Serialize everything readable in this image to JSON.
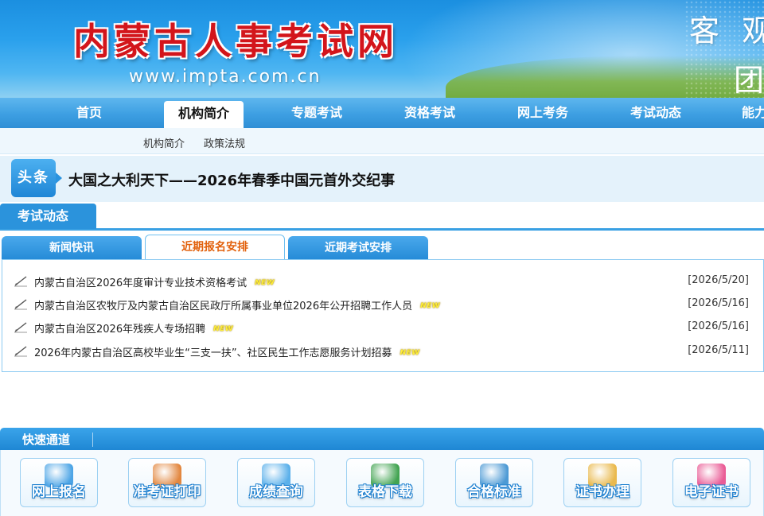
{
  "header": {
    "site_title": "内蒙古人事考试网",
    "site_url": "www.impta.com.cn",
    "slogan_line1": "客 观",
    "slogan_line2": "团"
  },
  "nav": {
    "items": [
      {
        "label": "首页"
      },
      {
        "label": "机构简介",
        "active": true
      },
      {
        "label": "专题考试"
      },
      {
        "label": "资格考试"
      },
      {
        "label": "网上考务"
      },
      {
        "label": "考试动态"
      },
      {
        "label": "能力"
      }
    ],
    "sub_items": [
      {
        "label": "机构简介"
      },
      {
        "label": "政策法规"
      }
    ]
  },
  "headline": {
    "badge": "头条",
    "text": "大国之大利天下——2026年春季中国元首外交纪事"
  },
  "exam_news": {
    "section_title": "考试动态",
    "tabs": [
      {
        "label": "新闻快讯"
      },
      {
        "label": "近期报名安排",
        "active": true
      },
      {
        "label": "近期考试安排"
      }
    ],
    "new_badge": "NEW",
    "items": [
      {
        "title": "内蒙古自治区2026年度审计专业技术资格考试",
        "date": "[2026/5/20]"
      },
      {
        "title": "内蒙古自治区农牧厅及内蒙古自治区民政厅所属事业单位2026年公开招聘工作人员",
        "date": "[2026/5/16]"
      },
      {
        "title": "内蒙古自治区2026年残疾人专场招聘",
        "date": "[2026/5/16]"
      },
      {
        "title": "2026年内蒙古自治区高校毕业生“三支一扶”、社区民生工作志愿服务计划招募",
        "date": "[2026/5/11]"
      }
    ]
  },
  "quick_channel": {
    "title": "快速通道",
    "buttons": [
      {
        "label": "网上报名",
        "icon": "online-registration-icon",
        "color": "#3a9be3"
      },
      {
        "label": "准考证打印",
        "icon": "printer-icon",
        "color": "#e07a2a"
      },
      {
        "label": "成绩查询",
        "icon": "score-query-icon",
        "color": "#4aa8e8"
      },
      {
        "label": "表格下载",
        "icon": "excel-icon",
        "color": "#2e9a3e"
      },
      {
        "label": "合格标准",
        "icon": "chart-icon",
        "color": "#3a8fd0"
      },
      {
        "label": "证书办理",
        "icon": "certificate-icon",
        "color": "#e8b23a"
      },
      {
        "label": "电子证书",
        "icon": "e-certificate-icon",
        "color": "#e84a8a"
      }
    ]
  }
}
